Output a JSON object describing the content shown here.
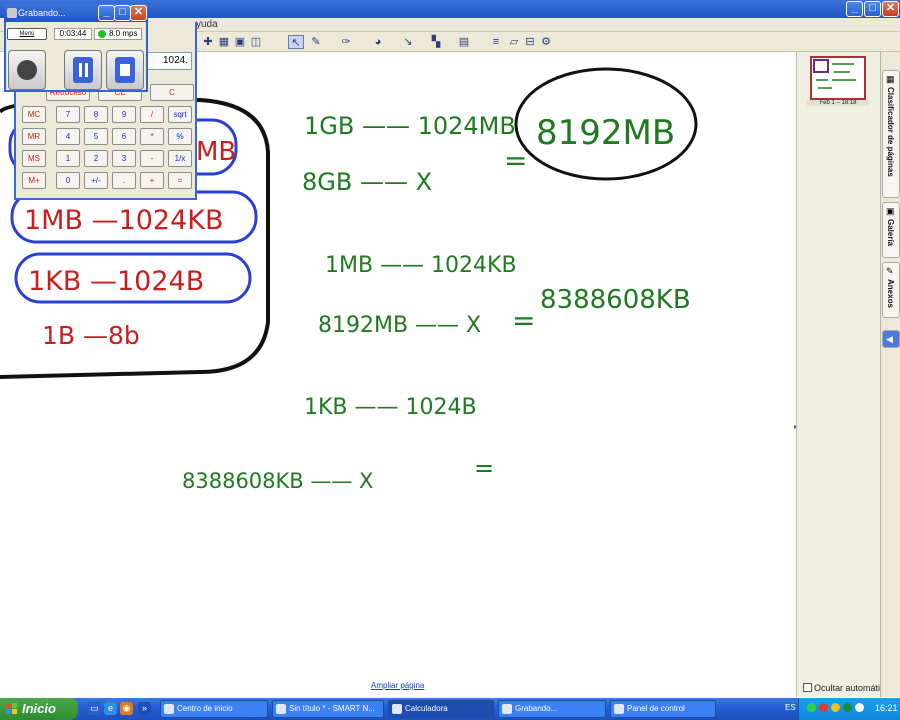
{
  "main_window": {
    "menu_partial": "yuda"
  },
  "canvas": {
    "left_column": [
      {
        "text": "1MB —1024KB",
        "color": "#c81e1e"
      },
      {
        "text": "1KB —1024B",
        "color": "#c81e1e"
      },
      {
        "text": "1B —8b",
        "color": "#c81e1e"
      }
    ],
    "left_partial_top": "MB",
    "right_lines": [
      "1GB —— 1024MB",
      "8GB —— X",
      "8192MB",
      "1MB —— 1024KB",
      "8192MB —— X",
      "8388608KB",
      "1KB —— 1024B",
      "8388608KB —— X"
    ],
    "equals": [
      "=",
      "=",
      "="
    ],
    "ink_color": "#1f7a1f",
    "circle_color": "#2a3fd4",
    "footer_link": "Ampliar página"
  },
  "sorter": {
    "thumb_label": "Feb 1 – 18:18",
    "hide_label": "Ocultar automátic"
  },
  "side_tabs": [
    {
      "label": "Clasificador de páginas",
      "icon": "pages-icon"
    },
    {
      "label": "Galería",
      "icon": "gallery-icon"
    },
    {
      "label": "Anexos",
      "icon": "attachments-icon"
    }
  ],
  "taskbar": {
    "start_label": "Inicio",
    "tasks": [
      {
        "label": "Centro de inicio"
      },
      {
        "label": "Sin título * - SMART N..."
      },
      {
        "label": "Calculadora"
      },
      {
        "label": "Grabando..."
      },
      {
        "label": "Panel de control"
      }
    ],
    "lang": "ES",
    "clock": "16:21"
  },
  "calculator": {
    "display": "1024.",
    "row0": [
      "Retroceso",
      "CE",
      "C"
    ],
    "rows": [
      [
        "MC",
        "7",
        "8",
        "9",
        "/",
        "sqrt"
      ],
      [
        "MR",
        "4",
        "5",
        "6",
        "*",
        "%"
      ],
      [
        "MS",
        "1",
        "2",
        "3",
        "-",
        "1/x"
      ],
      [
        "M+",
        "0",
        "+/-",
        ".",
        "+",
        "="
      ]
    ]
  },
  "recorder": {
    "title": "Grabando...",
    "menu_label": "Menú",
    "time": "0:03:44",
    "fps": "8.0 mps"
  }
}
